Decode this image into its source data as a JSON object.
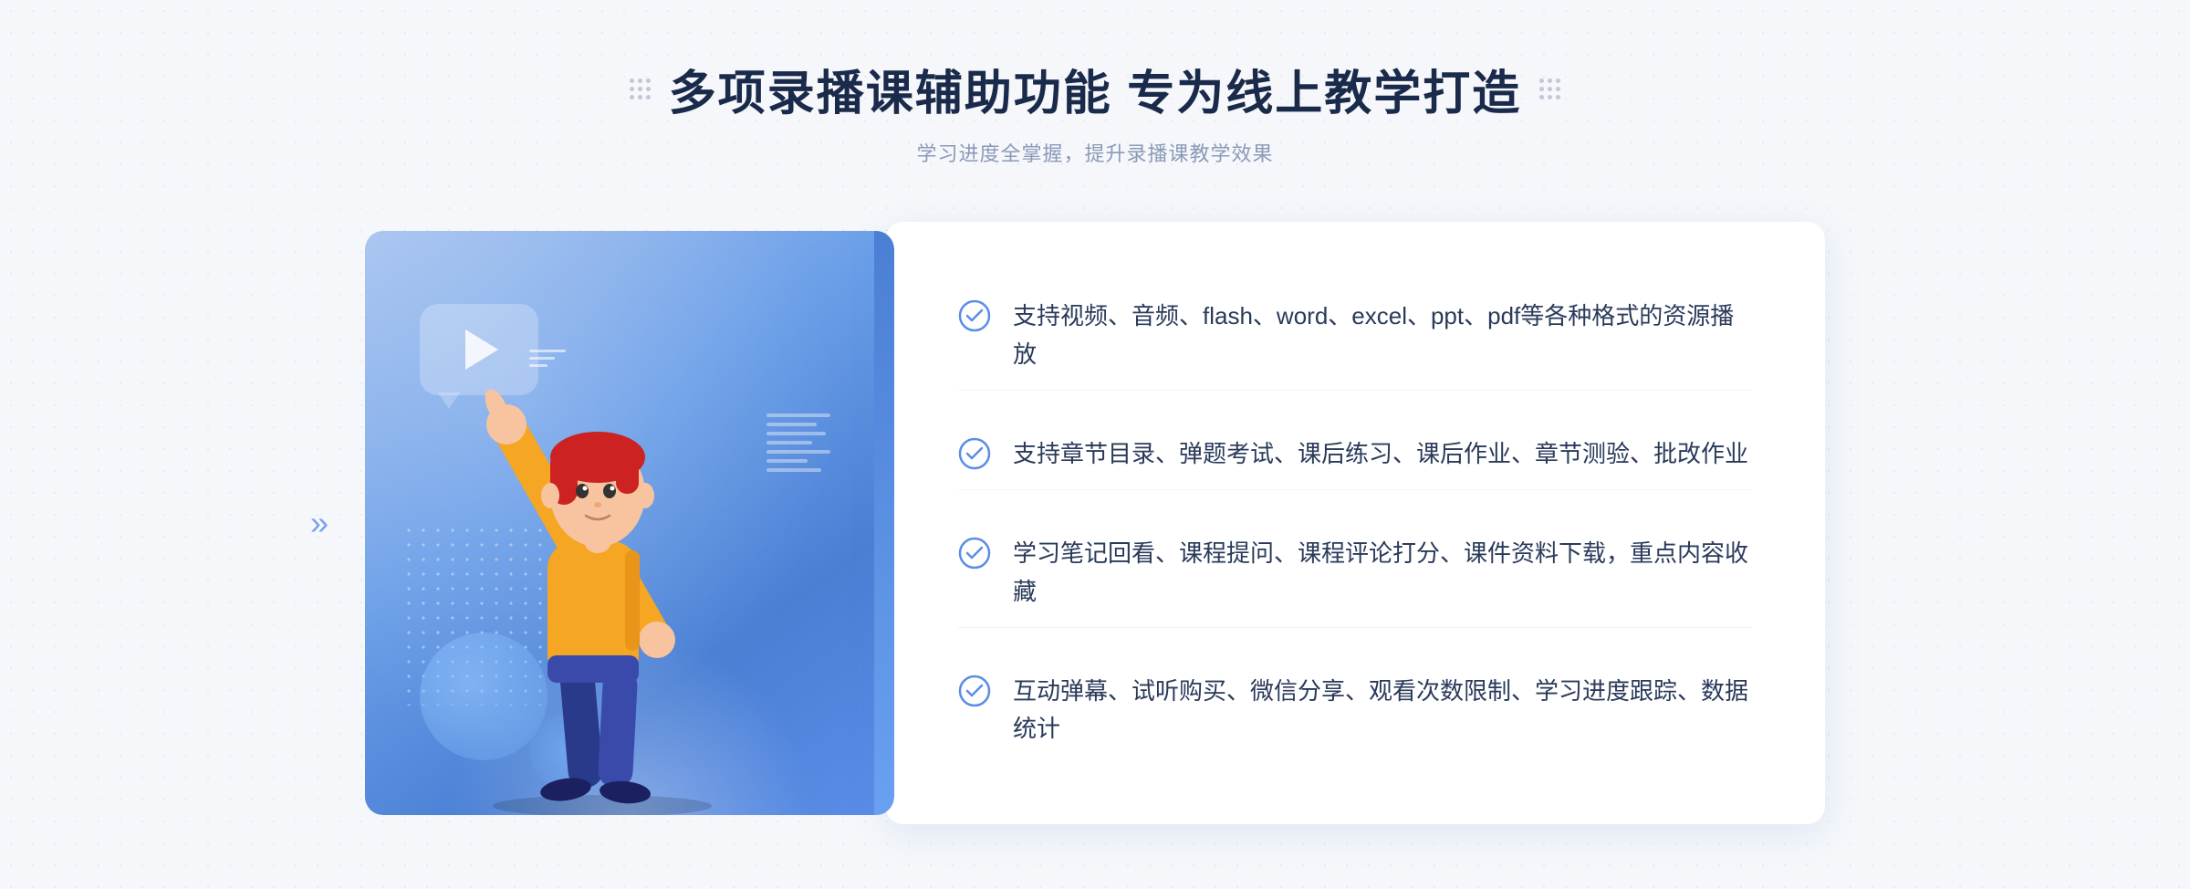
{
  "header": {
    "title": "多项录播课辅助功能 专为线上教学打造",
    "subtitle": "学习进度全掌握，提升录播课教学效果"
  },
  "features": [
    {
      "id": "feature-1",
      "text": "支持视频、音频、flash、word、excel、ppt、pdf等各种格式的资源播放"
    },
    {
      "id": "feature-2",
      "text": "支持章节目录、弹题考试、课后练习、课后作业、章节测验、批改作业"
    },
    {
      "id": "feature-3",
      "text": "学习笔记回看、课程提问、课程评论打分、课件资料下载，重点内容收藏"
    },
    {
      "id": "feature-4",
      "text": "互动弹幕、试听购买、微信分享、观看次数限制、学习进度跟踪、数据统计"
    }
  ],
  "decorative": {
    "arrow_char": "»",
    "check_color": "#5b8de8"
  }
}
